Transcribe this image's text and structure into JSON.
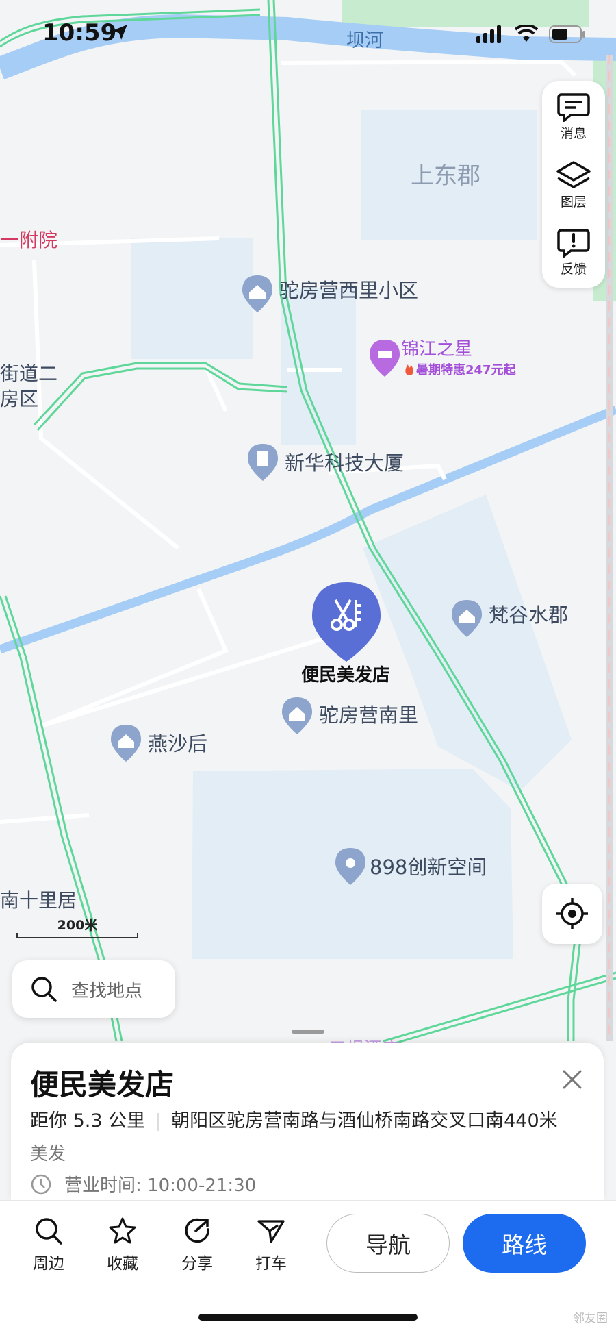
{
  "status_bar": {
    "time": "10:59"
  },
  "map": {
    "river_label": "坝河",
    "labels": {
      "shangdongjun": "上东郡",
      "yifuyuan": "一附院",
      "jiedao_line1": "街道二",
      "jiedao_line2": "房区",
      "nanshiliju": "南十里居"
    },
    "pois": [
      {
        "name": "驼房营西里小区",
        "icon": "residential-pin-icon"
      },
      {
        "name": "新华科技大厦",
        "icon": "office-building-pin-icon"
      },
      {
        "name": "梵谷水郡",
        "icon": "residential-pin-icon"
      },
      {
        "name": "驼房营南里",
        "icon": "residential-pin-icon"
      },
      {
        "name": "燕沙后",
        "icon": "residential-pin-icon"
      },
      {
        "name": "898创新空间",
        "icon": "location-pin-icon"
      }
    ],
    "hotel": {
      "name": "锦江之星",
      "promo": "暑期特惠247元起"
    },
    "selected_marker": {
      "name": "便民美发店",
      "icon": "scissors-icon"
    },
    "scale": "200米"
  },
  "side_panel": {
    "messages": "消息",
    "layers": "图层",
    "feedback": "反馈"
  },
  "search": {
    "placeholder": "查找地点"
  },
  "place_card": {
    "title": "便民美发店",
    "distance": "距你 5.3 公里",
    "address": "朝阳区驼房营南路与酒仙桥南路交叉口南440米",
    "category": "美发",
    "hours": "营业时间: 10:00-21:30"
  },
  "bottom_bar": {
    "nearby": "周边",
    "favorite": "收藏",
    "share": "分享",
    "taxi": "打车",
    "navigate": "导航",
    "route": "路线"
  },
  "watermark": "邻友圈",
  "colors": {
    "accent": "#1d6cf0",
    "marker": "#5a6fd6",
    "water": "#a6cdf5",
    "road": "#5fd79a",
    "hotel": "#a34fd8"
  }
}
